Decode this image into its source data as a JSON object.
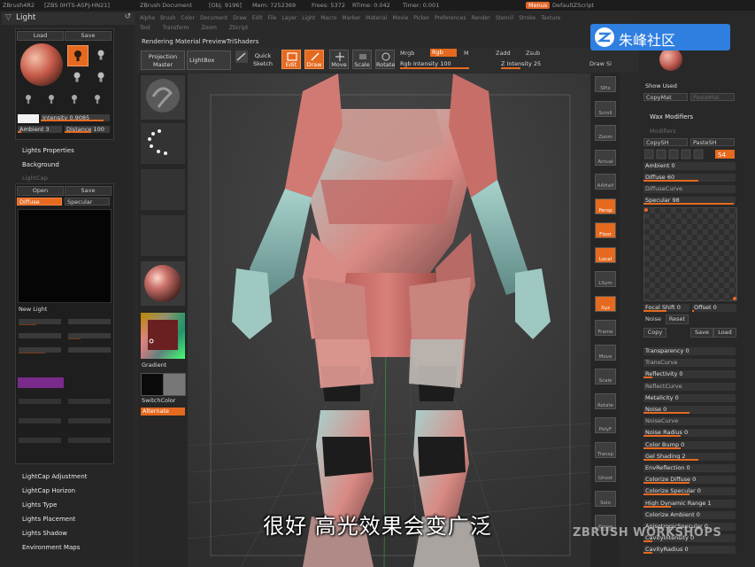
{
  "titlebar": {
    "app": "ZBrush4R2",
    "build": "[ZBS 0HTS-ASPJ-HN21]",
    "document": "ZBrush Document",
    "polys": "[Obj: 9196]",
    "mem": "Mem: 7252369",
    "frees": "Frees: 5372",
    "rtime": "RTime: 0.042",
    "timer": "Timer: 0.001",
    "menus_btn": "Menus",
    "script": "DefaultZScript"
  },
  "menubar": {
    "row1": [
      "Alpha",
      "Brush",
      "Color",
      "Document",
      "Draw",
      "Edit",
      "File",
      "Layer",
      "Light",
      "Macro",
      "Marker",
      "Material",
      "Movie",
      "Picker",
      "Preferences",
      "Render",
      "Stencil",
      "Stroke",
      "Texture"
    ],
    "row2": [
      "Tool",
      "Transform",
      "Zoom",
      "ZScript"
    ]
  },
  "left": {
    "title": "Light",
    "load": "Load",
    "save": "Save",
    "intensity_label": "Intensity",
    "intensity": "0.9085",
    "ambient_label": "Ambient",
    "ambient": "3",
    "distance_label": "Distance",
    "distance": "100",
    "lights_properties": "Lights Properties",
    "background": "Background",
    "lightcap": "LightCap",
    "open": "Open",
    "save2": "Save",
    "diffuse": "Diffuse",
    "specular": "Specular",
    "new_light": "New Light",
    "lightcap_adjustment": "LightCap Adjustment",
    "lightcap_horizon": "LightCap Horizon",
    "lights_type": "Lights Type",
    "lights_placement": "Lights Placement",
    "lights_shadow": "Lights Shadow",
    "environment_maps": "Environment Maps",
    "light_percent": 0.9085
  },
  "toolbar": {
    "rendering_label": "Rendering Material PreviewTriShaders",
    "projection_master": "Projection Master",
    "lightbox": "LightBox",
    "quick_sketch": "Quick Sketch",
    "edit": "Edit",
    "draw": "Draw",
    "move": "Move",
    "scale": "Scale",
    "rotate": "Rotate",
    "mrgb": "Mrgb",
    "rgb": "Rgb",
    "m": "M",
    "rgb_intensity_label": "Rgb Intensity",
    "rgb_intensity": "100",
    "zadd": "Zadd",
    "zsub": "Zsub",
    "z_intensity_label": "Z Intensity",
    "z_intensity": "25",
    "draw_size": "Draw Si"
  },
  "palette": {
    "gradient": "Gradient",
    "switchcolor": "SwitchColor",
    "alternate": "Alternate"
  },
  "shelf": [
    "SPix",
    "Scroll",
    "Zoom",
    "Actual",
    "AAHalf",
    "Persp",
    "Floor",
    "Local",
    "LSym",
    "Xyz",
    "Frame",
    "Move",
    "Scale",
    "Rotate",
    "PolyF",
    "Transp",
    "Ghost",
    "Solo",
    "Xpose"
  ],
  "right": {
    "show_used": "Show Used",
    "copymat": "CopyMat",
    "pastemat": "PasteMat",
    "wax_modifiers": "Wax Modifiers",
    "modifiers": "Modifiers",
    "copysh": "CopySH",
    "pastesh": "PasteSH",
    "ambient_label": "Ambient",
    "ambient": "0",
    "diffuse_label": "Diffuse",
    "diffuse": "60",
    "diffusecurve": "DiffuseCurve",
    "specular_label": "Specular",
    "specular": "98",
    "specular_pct": 0.98,
    "diffuse_pct": 0.6,
    "focal_shift_label": "Focal Shift",
    "focal_shift": "0",
    "offset_label": "Offset",
    "offset": "0",
    "noise": "Noise",
    "reset": "Reset",
    "copy": "Copy",
    "save": "Save",
    "load": "Load",
    "transparency_label": "Transparency",
    "transparency": "0",
    "transcurve": "TransCurve",
    "reflectivity_label": "Reflectivity",
    "reflectivity": "0",
    "reflectcurve": "ReflectCurve",
    "metalicity_label": "Metalicity",
    "metalicity": "0",
    "noise_label": "Noise",
    "noise_val": "0",
    "noisecurve": "NoiseCurve",
    "noise_radius_label": "Noise Radius",
    "noise_radius": "0",
    "color_bump_label": "Color Bump",
    "color_bump": "0",
    "gel_shading_label": "Gel Shading",
    "gel_shading": "2",
    "envreflection_label": "EnvReflection",
    "envreflection": "0",
    "colorize_diffuse_label": "Colorize Diffuse",
    "colorize_diffuse": "0",
    "colorize_specular_label": "Colorize Specular",
    "colorize_specular": "0",
    "hdr_label": "High Dynamic Range",
    "hdr": "1",
    "colorize_ambient_label": "Colorize Ambient",
    "colorize_ambient": "0",
    "aniso_label": "AnisotropicSpecular",
    "aniso": "0",
    "cavity_intensity_label": "CavityIntensity",
    "cavity_intensity": "0",
    "cavity_radius_label": "CavityRadius",
    "cavity_radius": "0"
  },
  "logo": {
    "text": "朱峰社区"
  },
  "subtitle": "很好  高光效果会变广泛",
  "watermark": "ZBRUSH WORKSHOPS",
  "colors": {
    "accent": "#e56a20",
    "skin": "#c96a66",
    "armor": "#8fb8b4",
    "bg": "#2b2b2b"
  }
}
